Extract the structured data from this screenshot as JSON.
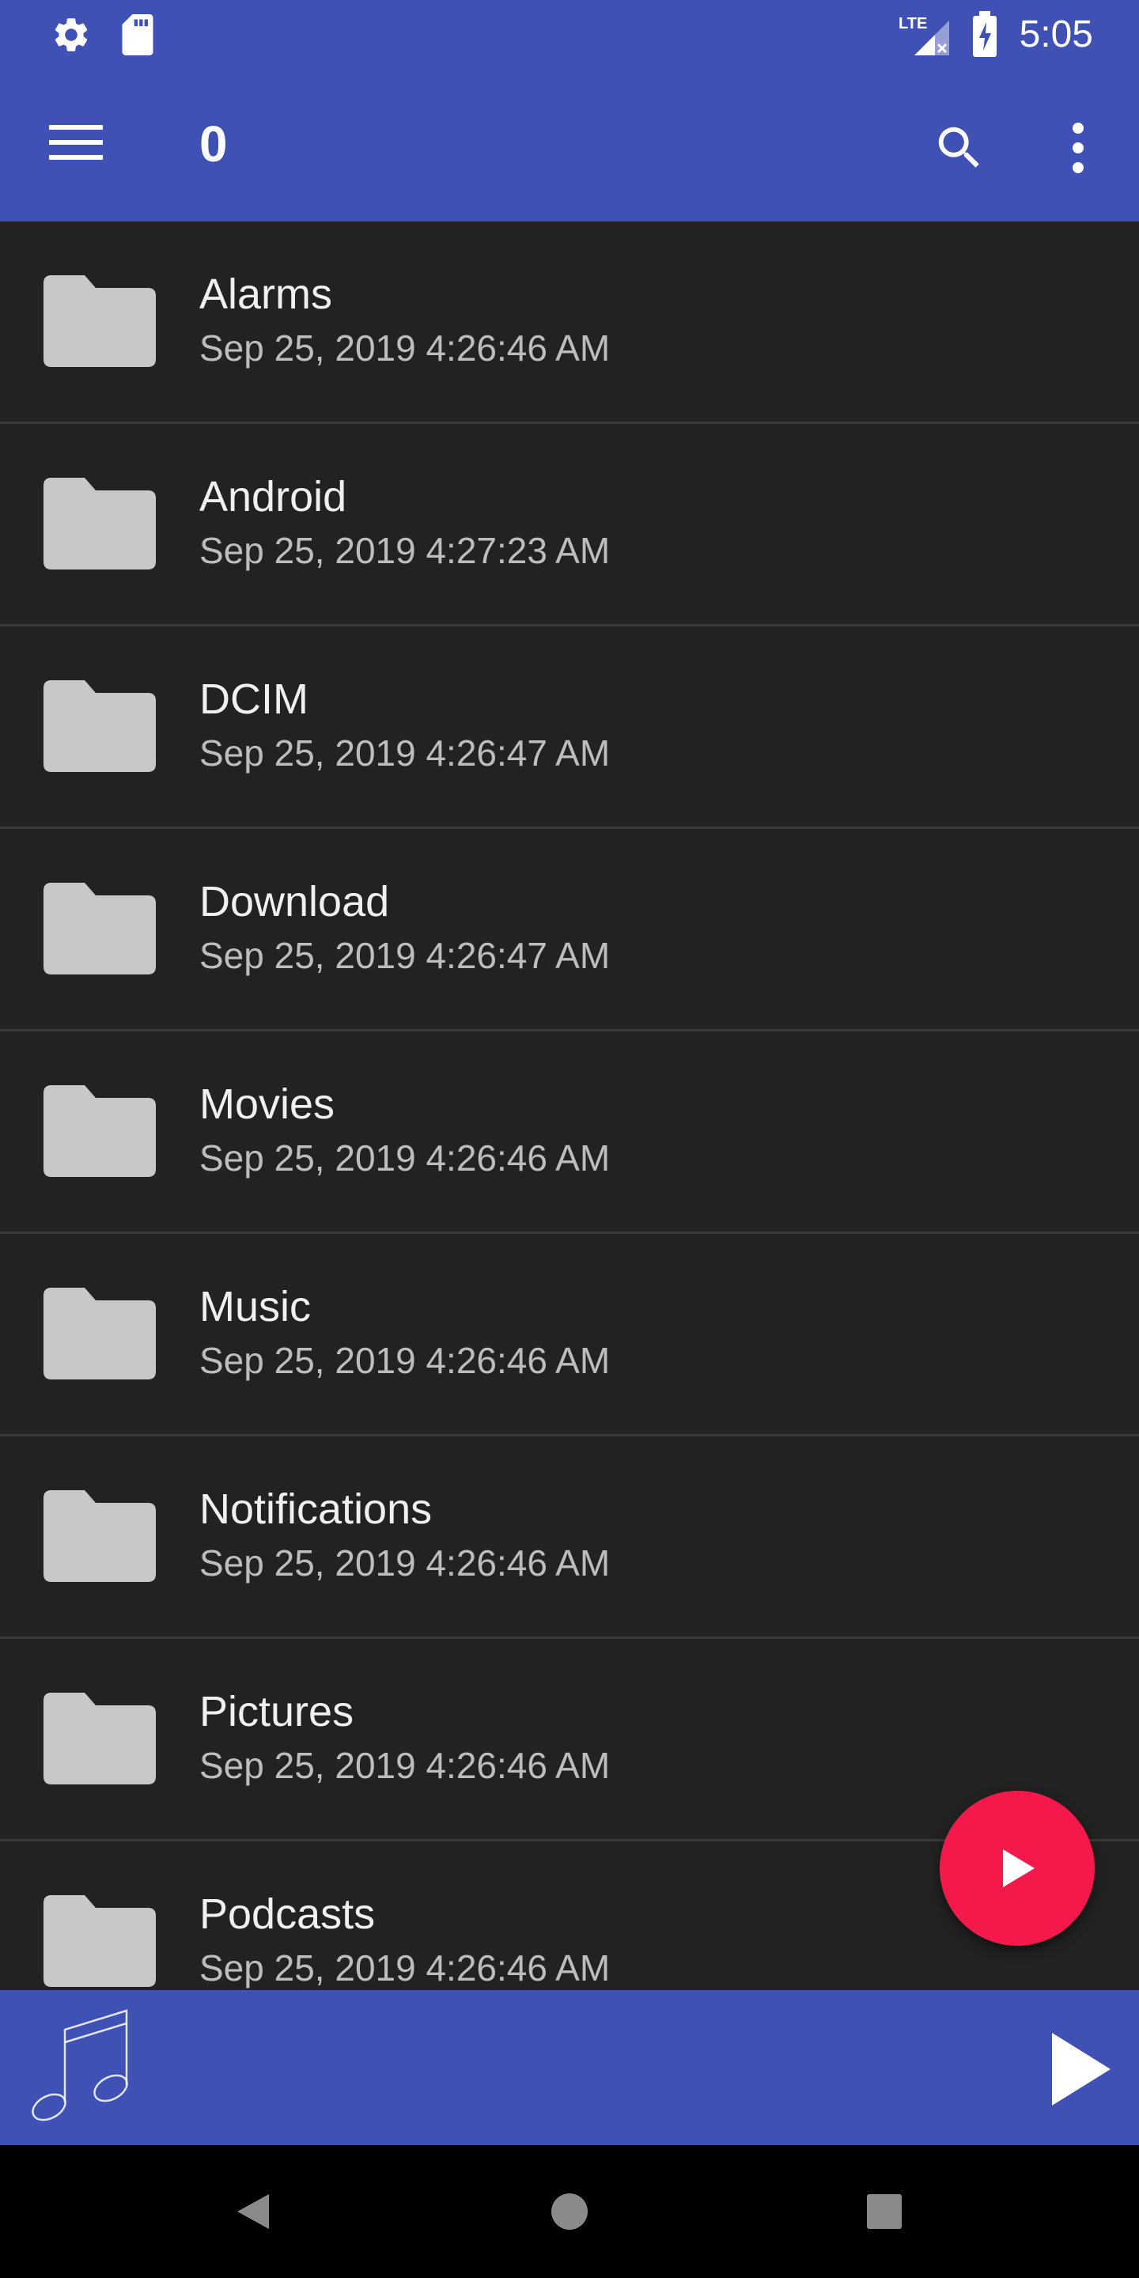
{
  "status_bar": {
    "time": "5:05",
    "network_label": "LTE",
    "icons": [
      "settings-icon",
      "sd-card-icon",
      "lte-signal-icon",
      "battery-charging-icon"
    ]
  },
  "app_bar": {
    "title": "0",
    "icons": [
      "menu-icon",
      "search-icon",
      "more-vert-icon"
    ]
  },
  "folders": [
    {
      "name": "Alarms",
      "date": "Sep 25, 2019 4:26:46 AM"
    },
    {
      "name": "Android",
      "date": "Sep 25, 2019 4:27:23 AM"
    },
    {
      "name": "DCIM",
      "date": "Sep 25, 2019 4:26:47 AM"
    },
    {
      "name": "Download",
      "date": "Sep 25, 2019 4:26:47 AM"
    },
    {
      "name": "Movies",
      "date": "Sep 25, 2019 4:26:46 AM"
    },
    {
      "name": "Music",
      "date": "Sep 25, 2019 4:26:46 AM"
    },
    {
      "name": "Notifications",
      "date": "Sep 25, 2019 4:26:46 AM"
    },
    {
      "name": "Pictures",
      "date": "Sep 25, 2019 4:26:46 AM"
    },
    {
      "name": "Podcasts",
      "date": "Sep 25, 2019 4:26:46 AM"
    }
  ],
  "player": {
    "icons": [
      "music-note-icon",
      "play-icon"
    ]
  },
  "fab": {
    "icon": "play-icon"
  },
  "nav": {
    "icons": [
      "back-icon",
      "home-icon",
      "recents-icon"
    ]
  },
  "colors": {
    "primary": "#3f51b5",
    "accent": "#f5194b",
    "background": "#222222",
    "divider": "#3a3a3a",
    "text_primary": "#f0f0f0",
    "text_secondary": "#bdbdbd",
    "folder_icon": "#c8c8c8"
  }
}
